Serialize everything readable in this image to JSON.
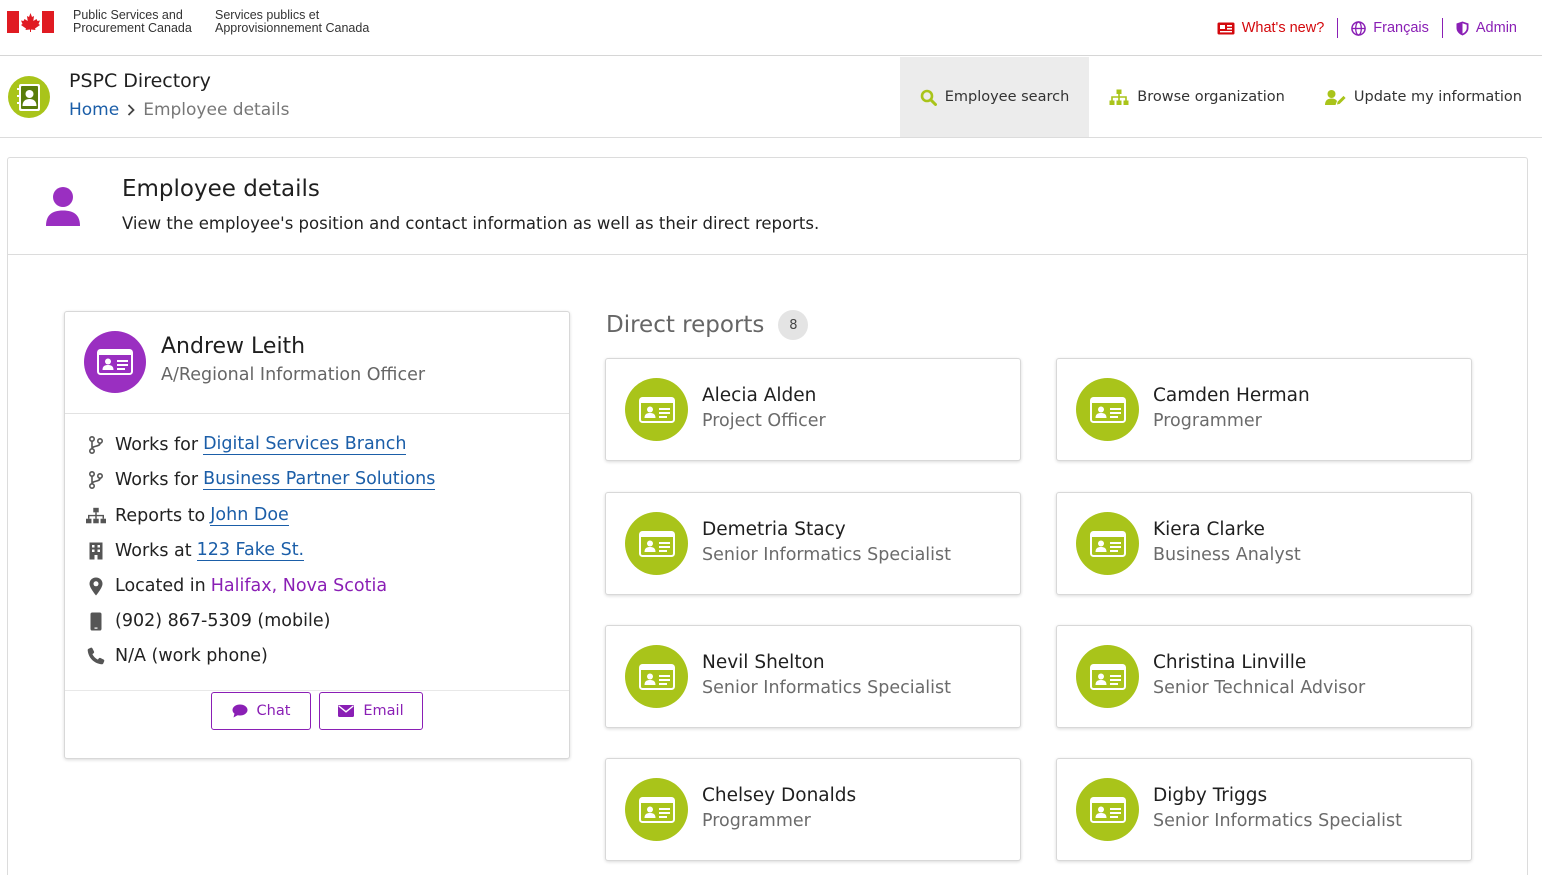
{
  "gc_header": {
    "dept_en_line1": "Public Services and",
    "dept_en_line2": "Procurement Canada",
    "dept_fr_line1": "Services publics et",
    "dept_fr_line2": "Approvisionnement Canada",
    "whats_new": "What's new?",
    "language": "Français",
    "admin": "Admin"
  },
  "app": {
    "title": "PSPC Directory",
    "breadcrumb": {
      "home": "Home",
      "current": "Employee details"
    }
  },
  "nav": {
    "items": [
      {
        "label": "Employee search",
        "icon": "search-icon",
        "active": true
      },
      {
        "label": "Browse organization",
        "icon": "org-chart-icon",
        "active": false
      },
      {
        "label": "Update my information",
        "icon": "user-edit-icon",
        "active": false
      }
    ]
  },
  "page": {
    "title": "Employee details",
    "description": "View the employee's position and contact information as well as their direct reports."
  },
  "employee": {
    "name": "Andrew Leith",
    "title": "A/Regional Information Officer",
    "works_for_prefix": "Works for",
    "works_for_1": "Digital Services Branch",
    "works_for_2": "Business Partner Solutions",
    "reports_to_prefix": "Reports to",
    "reports_to": "John Doe",
    "works_at_prefix": "Works at",
    "works_at": "123 Fake St.",
    "located_prefix": "Located in",
    "location": "Halifax, Nova Scotia",
    "mobile": "(902) 867-5309 (mobile)",
    "work_phone": "N/A (work phone)",
    "chat_label": "Chat",
    "email_label": "Email"
  },
  "direct_reports": {
    "heading": "Direct reports",
    "count": "8",
    "items": [
      {
        "name": "Alecia Alden",
        "title": "Project Officer"
      },
      {
        "name": "Camden Herman",
        "title": "Programmer"
      },
      {
        "name": "Demetria Stacy",
        "title": "Senior Informatics Specialist"
      },
      {
        "name": "Kiera Clarke",
        "title": "Business Analyst"
      },
      {
        "name": "Nevil Shelton",
        "title": "Senior Informatics Specialist"
      },
      {
        "name": "Christina Linville",
        "title": "Senior Technical Advisor"
      },
      {
        "name": "Chelsey Donalds",
        "title": "Programmer"
      },
      {
        "name": "Digby Triggs",
        "title": "Senior Informatics Specialist"
      }
    ]
  },
  "colors": {
    "brand_purple": "#8a1fb5",
    "avatar_purple": "#9a2fc1",
    "report_green": "#a9c41a",
    "link_blue": "#1b5ea8",
    "gc_red": "#d3080c"
  }
}
